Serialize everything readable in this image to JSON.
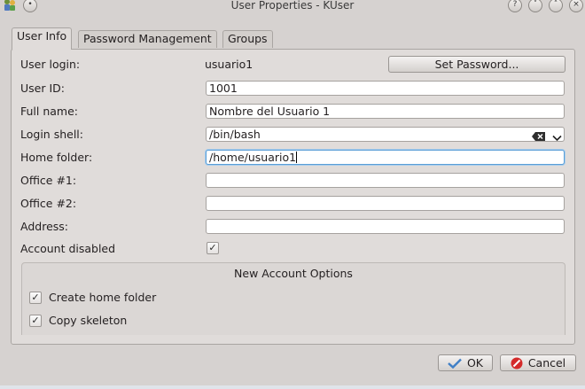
{
  "window": {
    "title": "User Properties - KUser",
    "buttons": {
      "help": "?",
      "minimize": "˅",
      "maximize": "˄",
      "close": "×"
    }
  },
  "tabs": [
    {
      "label": "User Info",
      "active": true
    },
    {
      "label": "Password Management",
      "active": false
    },
    {
      "label": "Groups",
      "active": false
    }
  ],
  "user_info": {
    "user_login_label": "User login:",
    "user_login_value": "usuario1",
    "set_password_label": "Set Password...",
    "user_id_label": "User ID:",
    "user_id_value": "1001",
    "full_name_label": "Full name:",
    "full_name_value": "Nombre del Usuario 1",
    "login_shell_label": "Login shell:",
    "login_shell_value": "/bin/bash",
    "home_folder_label": "Home folder:",
    "home_folder_value": "/home/usuario1",
    "office1_label": "Office #1:",
    "office1_value": "",
    "office2_label": "Office #2:",
    "office2_value": "",
    "address_label": "Address:",
    "address_value": "",
    "account_disabled_label": "Account disabled",
    "account_disabled_checked": true
  },
  "new_account_options": {
    "title": "New Account Options",
    "create_home_label": "Create home folder",
    "create_home_checked": true,
    "copy_skeleton_label": "Copy skeleton",
    "copy_skeleton_checked": true
  },
  "footer": {
    "ok_label": "OK",
    "cancel_label": "Cancel"
  },
  "icons": {
    "app": "kuser-app-icon",
    "check": "✓",
    "clear": "clear-text-icon",
    "dropdown": "chevron-down-icon"
  },
  "colors": {
    "focus_border": "#5a9ed6",
    "ok_icon": "#3f7fc6",
    "cancel_icon": "#d42a2a"
  }
}
